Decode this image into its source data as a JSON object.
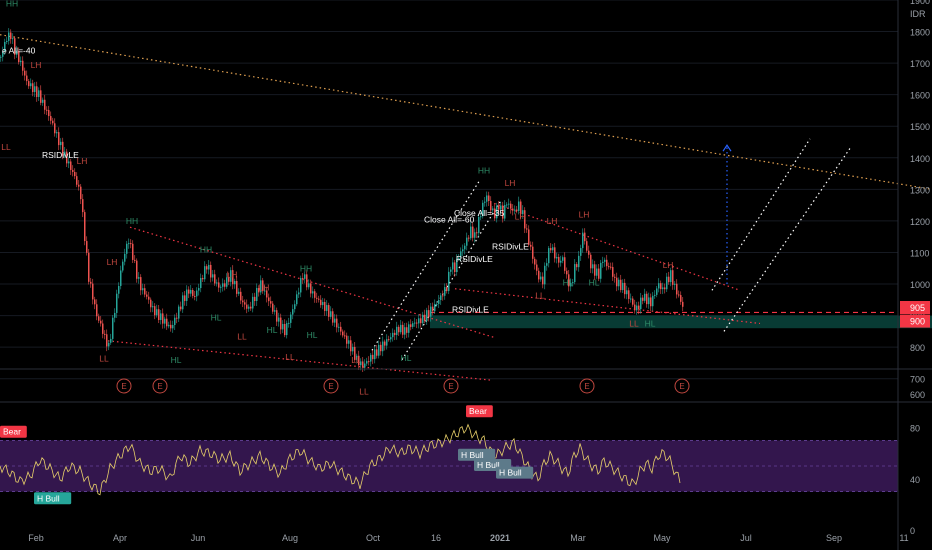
{
  "chart_data": {
    "type": "candlestick",
    "currency": "IDR",
    "price_axis": {
      "ticks": [
        "1900",
        "1800",
        "1700",
        "1600",
        "1500",
        "1400",
        "1300",
        "1200",
        "1100",
        "1000",
        "900",
        "800",
        "700"
      ],
      "ylim": [
        680,
        1900
      ]
    },
    "rsi_axis": {
      "ticks": [
        "600",
        "80",
        "40",
        "0"
      ],
      "ylim": [
        0,
        100
      ],
      "band": [
        30,
        70
      ]
    },
    "time_axis": {
      "ticks": [
        "Feb",
        "Apr",
        "Jun",
        "Aug",
        "Oct",
        "16",
        "2021",
        "Mar",
        "May",
        "Jul",
        "Sep",
        "11"
      ]
    },
    "price_labels": [
      {
        "text": "905",
        "value": 905,
        "color": "#f23645"
      },
      {
        "text": "900",
        "value": 900,
        "color": "#f23645"
      }
    ],
    "series_points": [
      [
        0,
        1720
      ],
      [
        6,
        1780
      ],
      [
        10,
        1790
      ],
      [
        14,
        1740
      ],
      [
        20,
        1700
      ],
      [
        26,
        1640
      ],
      [
        32,
        1620
      ],
      [
        38,
        1600
      ],
      [
        44,
        1560
      ],
      [
        50,
        1520
      ],
      [
        56,
        1470
      ],
      [
        62,
        1420
      ],
      [
        68,
        1380
      ],
      [
        74,
        1340
      ],
      [
        80,
        1280
      ],
      [
        84,
        1150
      ],
      [
        88,
        1020
      ],
      [
        92,
        960
      ],
      [
        96,
        900
      ],
      [
        100,
        870
      ],
      [
        104,
        830
      ],
      [
        108,
        800
      ],
      [
        112,
        880
      ],
      [
        116,
        960
      ],
      [
        120,
        1040
      ],
      [
        124,
        1100
      ],
      [
        128,
        1140
      ],
      [
        132,
        1090
      ],
      [
        136,
        1030
      ],
      [
        140,
        990
      ],
      [
        146,
        960
      ],
      [
        152,
        920
      ],
      [
        158,
        900
      ],
      [
        164,
        880
      ],
      [
        170,
        860
      ],
      [
        176,
        900
      ],
      [
        182,
        950
      ],
      [
        188,
        980
      ],
      [
        194,
        960
      ],
      [
        200,
        1010
      ],
      [
        206,
        1060
      ],
      [
        212,
        1020
      ],
      [
        218,
        990
      ],
      [
        224,
        1000
      ],
      [
        230,
        1030
      ],
      [
        236,
        980
      ],
      [
        242,
        940
      ],
      [
        248,
        920
      ],
      [
        254,
        960
      ],
      [
        260,
        1000
      ],
      [
        266,
        960
      ],
      [
        272,
        920
      ],
      [
        278,
        880
      ],
      [
        284,
        850
      ],
      [
        290,
        900
      ],
      [
        296,
        960
      ],
      [
        302,
        1030
      ],
      [
        308,
        990
      ],
      [
        314,
        960
      ],
      [
        320,
        940
      ],
      [
        326,
        920
      ],
      [
        332,
        890
      ],
      [
        338,
        860
      ],
      [
        344,
        830
      ],
      [
        350,
        800
      ],
      [
        356,
        760
      ],
      [
        362,
        740
      ],
      [
        368,
        760
      ],
      [
        374,
        780
      ],
      [
        380,
        800
      ],
      [
        386,
        820
      ],
      [
        392,
        840
      ],
      [
        398,
        860
      ],
      [
        404,
        850
      ],
      [
        410,
        870
      ],
      [
        416,
        880
      ],
      [
        422,
        890
      ],
      [
        428,
        910
      ],
      [
        434,
        930
      ],
      [
        440,
        960
      ],
      [
        446,
        990
      ],
      [
        450,
        1060
      ],
      [
        454,
        1050
      ],
      [
        458,
        1090
      ],
      [
        462,
        1110
      ],
      [
        466,
        1140
      ],
      [
        470,
        1170
      ],
      [
        474,
        1150
      ],
      [
        478,
        1200
      ],
      [
        482,
        1250
      ],
      [
        486,
        1280
      ],
      [
        490,
        1240
      ],
      [
        494,
        1220
      ],
      [
        498,
        1250
      ],
      [
        502,
        1220
      ],
      [
        506,
        1260
      ],
      [
        510,
        1240
      ],
      [
        514,
        1230
      ],
      [
        518,
        1250
      ],
      [
        522,
        1220
      ],
      [
        526,
        1160
      ],
      [
        530,
        1110
      ],
      [
        534,
        1060
      ],
      [
        538,
        1020
      ],
      [
        542,
        1010
      ],
      [
        546,
        1080
      ],
      [
        550,
        1120
      ],
      [
        554,
        1090
      ],
      [
        558,
        1070
      ],
      [
        562,
        1080
      ],
      [
        566,
        1020
      ],
      [
        570,
        990
      ],
      [
        574,
        1050
      ],
      [
        578,
        1080
      ],
      [
        582,
        1160
      ],
      [
        586,
        1110
      ],
      [
        590,
        1060
      ],
      [
        594,
        1040
      ],
      [
        598,
        1030
      ],
      [
        602,
        1080
      ],
      [
        606,
        1060
      ],
      [
        610,
        1050
      ],
      [
        614,
        1010
      ],
      [
        618,
        1000
      ],
      [
        622,
        990
      ],
      [
        626,
        970
      ],
      [
        630,
        950
      ],
      [
        634,
        920
      ],
      [
        638,
        930
      ],
      [
        642,
        960
      ],
      [
        646,
        950
      ],
      [
        650,
        940
      ],
      [
        654,
        970
      ],
      [
        658,
        1000
      ],
      [
        662,
        980
      ],
      [
        666,
        1010
      ],
      [
        670,
        1030
      ],
      [
        674,
        990
      ],
      [
        678,
        960
      ],
      [
        682,
        930
      ],
      [
        684,
        905
      ]
    ],
    "rsi_points": [
      [
        0,
        50
      ],
      [
        10,
        45
      ],
      [
        20,
        38
      ],
      [
        30,
        42
      ],
      [
        40,
        55
      ],
      [
        50,
        48
      ],
      [
        60,
        40
      ],
      [
        70,
        50
      ],
      [
        80,
        46
      ],
      [
        90,
        36
      ],
      [
        100,
        30
      ],
      [
        110,
        48
      ],
      [
        120,
        58
      ],
      [
        130,
        66
      ],
      [
        140,
        52
      ],
      [
        150,
        46
      ],
      [
        160,
        48
      ],
      [
        170,
        40
      ],
      [
        180,
        58
      ],
      [
        190,
        52
      ],
      [
        200,
        62
      ],
      [
        210,
        60
      ],
      [
        220,
        55
      ],
      [
        230,
        58
      ],
      [
        240,
        46
      ],
      [
        250,
        52
      ],
      [
        260,
        58
      ],
      [
        270,
        50
      ],
      [
        280,
        44
      ],
      [
        290,
        56
      ],
      [
        300,
        62
      ],
      [
        310,
        54
      ],
      [
        320,
        48
      ],
      [
        330,
        52
      ],
      [
        340,
        46
      ],
      [
        350,
        40
      ],
      [
        360,
        36
      ],
      [
        370,
        50
      ],
      [
        380,
        56
      ],
      [
        390,
        64
      ],
      [
        400,
        60
      ],
      [
        410,
        64
      ],
      [
        420,
        60
      ],
      [
        430,
        66
      ],
      [
        440,
        68
      ],
      [
        450,
        72
      ],
      [
        458,
        76
      ],
      [
        462,
        78
      ],
      [
        466,
        80
      ],
      [
        472,
        76
      ],
      [
        478,
        72
      ],
      [
        484,
        70
      ],
      [
        490,
        62
      ],
      [
        496,
        58
      ],
      [
        502,
        62
      ],
      [
        508,
        66
      ],
      [
        514,
        68
      ],
      [
        520,
        60
      ],
      [
        526,
        52
      ],
      [
        532,
        44
      ],
      [
        538,
        40
      ],
      [
        544,
        52
      ],
      [
        550,
        58
      ],
      [
        556,
        54
      ],
      [
        562,
        48
      ],
      [
        568,
        44
      ],
      [
        574,
        58
      ],
      [
        580,
        64
      ],
      [
        586,
        56
      ],
      [
        592,
        50
      ],
      [
        598,
        46
      ],
      [
        604,
        54
      ],
      [
        610,
        50
      ],
      [
        616,
        46
      ],
      [
        622,
        42
      ],
      [
        628,
        38
      ],
      [
        634,
        36
      ],
      [
        640,
        46
      ],
      [
        646,
        52
      ],
      [
        652,
        48
      ],
      [
        658,
        58
      ],
      [
        664,
        60
      ],
      [
        670,
        54
      ],
      [
        676,
        44
      ],
      [
        682,
        36
      ]
    ],
    "trend_lines": [
      {
        "from": [
          0,
          1790
        ],
        "to": [
          932,
          1300
        ],
        "color": "#e0a050",
        "style": "dotted"
      },
      {
        "from": [
          130,
          1180
        ],
        "to": [
          495,
          830
        ],
        "color": "#f23645",
        "style": "dotted"
      },
      {
        "from": [
          108,
          820
        ],
        "to": [
          492,
          695
        ],
        "color": "#f23645",
        "style": "dotted"
      },
      {
        "from": [
          490,
          1260
        ],
        "to": [
          740,
          980
        ],
        "color": "#f23645",
        "style": "dotted"
      },
      {
        "from": [
          455,
          985
        ],
        "to": [
          760,
          875
        ],
        "color": "#f23645",
        "style": "dotted"
      },
      {
        "from": [
          372,
          790
        ],
        "to": [
          480,
          1330
        ],
        "color": "#ffffff",
        "style": "dotted"
      },
      {
        "from": [
          402,
          760
        ],
        "to": [
          500,
          1260
        ],
        "color": "#ffffff",
        "style": "dotted"
      },
      {
        "from": [
          712,
          980
        ],
        "to": [
          810,
          1460
        ],
        "color": "#ffffff",
        "style": "dotted"
      },
      {
        "from": [
          724,
          850
        ],
        "to": [
          850,
          1430
        ],
        "color": "#ffffff",
        "style": "dotted"
      },
      {
        "from": [
          727,
          1000
        ],
        "to": [
          727,
          1440
        ],
        "color": "#2962ff",
        "style": "dotted-arrow"
      }
    ],
    "support_zone": {
      "x_start": 430,
      "x_end": 932,
      "top": 900,
      "bottom": 860,
      "color": "#0b4f46"
    },
    "support_line": {
      "value": 910,
      "color": "#f23645",
      "style": "dashed",
      "x_start": 430
    },
    "pivot_labels": [
      {
        "text": "HH",
        "x": 12,
        "y": 1880
      },
      {
        "text": "LH",
        "x": 36,
        "y": 1685
      },
      {
        "text": "LL",
        "x": 6,
        "y": 1450
      },
      {
        "text": "LH",
        "x": 82,
        "y": 1380
      },
      {
        "text": "LH",
        "x": 112,
        "y": 1060
      },
      {
        "text": "LL",
        "x": 104,
        "y": 780
      },
      {
        "text": "HH",
        "x": 132,
        "y": 1190
      },
      {
        "text": "HL",
        "x": 176,
        "y": 775
      },
      {
        "text": "HH",
        "x": 206,
        "y": 1100
      },
      {
        "text": "LH",
        "x": 232,
        "y": 1020
      },
      {
        "text": "LH",
        "x": 264,
        "y": 980
      },
      {
        "text": "HL",
        "x": 216,
        "y": 910
      },
      {
        "text": "LL",
        "x": 242,
        "y": 850
      },
      {
        "text": "HL",
        "x": 272,
        "y": 870
      },
      {
        "text": "LL",
        "x": 290,
        "y": 785
      },
      {
        "text": "HH",
        "x": 306,
        "y": 1040
      },
      {
        "text": "HL",
        "x": 312,
        "y": 855
      },
      {
        "text": "LL",
        "x": 356,
        "y": 775
      },
      {
        "text": "LL",
        "x": 364,
        "y": 675
      },
      {
        "text": "HL",
        "x": 406,
        "y": 782
      },
      {
        "text": "HH",
        "x": 484,
        "y": 1350
      },
      {
        "text": "LH",
        "x": 510,
        "y": 1310
      },
      {
        "text": "LH",
        "x": 520,
        "y": 1205
      },
      {
        "text": "LL",
        "x": 540,
        "y": 980
      },
      {
        "text": "LH",
        "x": 552,
        "y": 1190
      },
      {
        "text": "LH",
        "x": 584,
        "y": 1210
      },
      {
        "text": "HL",
        "x": 568,
        "y": 1020
      },
      {
        "text": "HL",
        "x": 594,
        "y": 1020
      },
      {
        "text": "LL",
        "x": 634,
        "y": 890
      },
      {
        "text": "HL",
        "x": 650,
        "y": 890
      },
      {
        "text": "LH",
        "x": 668,
        "y": 1050
      }
    ],
    "strategy_labels": [
      {
        "text": "e All=-40",
        "x": 2,
        "y": 1730,
        "color": "#ffffff"
      },
      {
        "text": "RSIDivLE",
        "x": 42,
        "y": 1400,
        "color": "#ffffff"
      },
      {
        "text": "Close All=-60",
        "x": 424,
        "y": 1195,
        "color": "#ffffff"
      },
      {
        "text": "Close All=-35",
        "x": 454,
        "y": 1215,
        "color": "#ffffff"
      },
      {
        "text": "RSIDivLE",
        "x": 456,
        "y": 1070,
        "color": "#ffffff"
      },
      {
        "text": "RSIDivLE",
        "x": 492,
        "y": 1110,
        "color": "#ffffff"
      },
      {
        "text": "RSIDivLE",
        "x": 452,
        "y": 910,
        "color": "#ffffff"
      }
    ],
    "event_markers": [
      {
        "text": "E",
        "x": 124
      },
      {
        "text": "E",
        "x": 160
      },
      {
        "text": "E",
        "x": 331
      },
      {
        "text": "E",
        "x": 451
      },
      {
        "text": "E",
        "x": 587
      },
      {
        "text": "E",
        "x": 682
      }
    ],
    "rsi_badges": [
      {
        "text": "Bear",
        "x": 0,
        "y": 76,
        "color": "#f23645"
      },
      {
        "text": "H Bull",
        "x": 34,
        "y": 24,
        "color": "#26a69a"
      },
      {
        "text": "Bear",
        "x": 466,
        "y": 92,
        "color": "#f23645"
      },
      {
        "text": "H Bull",
        "x": 458,
        "y": 58,
        "color": "#5d7a8a"
      },
      {
        "text": "H Bull",
        "x": 474,
        "y": 50,
        "color": "#5d7a8a"
      },
      {
        "text": "H Bull",
        "x": 496,
        "y": 44,
        "color": "#5d7a8a"
      }
    ]
  }
}
